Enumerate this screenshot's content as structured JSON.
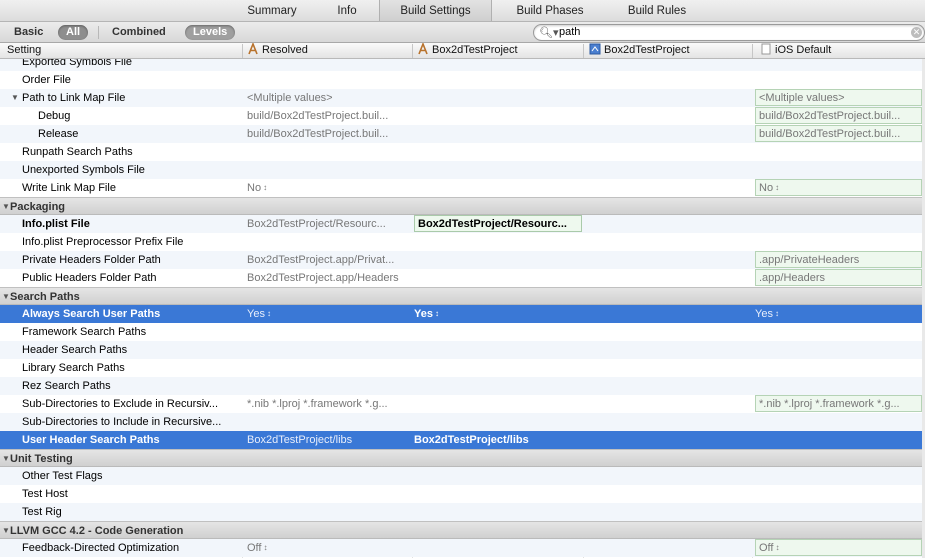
{
  "tabs": [
    {
      "label": "Summary",
      "active": false
    },
    {
      "label": "Info",
      "active": false
    },
    {
      "label": "Build Settings",
      "active": true
    },
    {
      "label": "Build Phases",
      "active": false
    },
    {
      "label": "Build Rules",
      "active": false
    }
  ],
  "filter": {
    "basic": "Basic",
    "all": "All",
    "combined": "Combined",
    "levels": "Levels",
    "search_value": "path",
    "search_icon": "magnifier-icon",
    "clear_icon": "clear-icon"
  },
  "columns": {
    "setting": "Setting",
    "resolved": "Resolved",
    "target": "Box2dTestProject",
    "project": "Box2dTestProject",
    "ios_default": "iOS Default"
  },
  "rows": [
    {
      "type": "setting",
      "name": "Exported Symbols File"
    },
    {
      "type": "setting",
      "name": "Order File"
    },
    {
      "type": "setting",
      "name": "Path to Link Map File",
      "expanded": true,
      "resolved": "<Multiple values>",
      "ios": "<Multiple values>"
    },
    {
      "type": "child",
      "name": "Debug",
      "resolved": "build/Box2dTestProject.buil...",
      "ios": "build/Box2dTestProject.buil..."
    },
    {
      "type": "child",
      "name": "Release",
      "resolved": "build/Box2dTestProject.buil...",
      "ios": "build/Box2dTestProject.buil..."
    },
    {
      "type": "setting",
      "name": "Runpath Search Paths"
    },
    {
      "type": "setting",
      "name": "Unexported Symbols File"
    },
    {
      "type": "setting",
      "name": "Write Link Map File",
      "resolved": "No",
      "resolved_stepper": true,
      "ios": "No",
      "ios_stepper": true
    },
    {
      "type": "section",
      "name": "Packaging"
    },
    {
      "type": "setting",
      "name": "Info.plist File",
      "bold": true,
      "resolved": "Box2dTestProject/Resourc...",
      "target": "Box2dTestProject/Resourc..."
    },
    {
      "type": "setting",
      "name": "Info.plist Preprocessor Prefix File"
    },
    {
      "type": "setting",
      "name": "Private Headers Folder Path",
      "resolved": "Box2dTestProject.app/Privat...",
      "ios": ".app/PrivateHeaders"
    },
    {
      "type": "setting",
      "name": "Public Headers Folder Path",
      "resolved": "Box2dTestProject.app/Headers",
      "ios": ".app/Headers"
    },
    {
      "type": "section",
      "name": "Search Paths"
    },
    {
      "type": "setting",
      "name": "Always Search User Paths",
      "bold": true,
      "selected": true,
      "resolved": "Yes",
      "resolved_stepper": true,
      "target": "Yes",
      "target_stepper": true,
      "ios": "Yes",
      "ios_stepper": true
    },
    {
      "type": "setting",
      "name": "Framework Search Paths"
    },
    {
      "type": "setting",
      "name": "Header Search Paths"
    },
    {
      "type": "setting",
      "name": "Library Search Paths"
    },
    {
      "type": "setting",
      "name": "Rez Search Paths"
    },
    {
      "type": "setting",
      "name": "Sub-Directories to Exclude in Recursiv...",
      "resolved": "*.nib *.lproj *.framework *.g...",
      "ios": "*.nib *.lproj *.framework *.g..."
    },
    {
      "type": "setting",
      "name": "Sub-Directories to Include in Recursive..."
    },
    {
      "type": "setting",
      "name": "User Header Search Paths",
      "bold": true,
      "selected": true,
      "resolved": "Box2dTestProject/libs",
      "target": "Box2dTestProject/libs"
    },
    {
      "type": "section",
      "name": "Unit Testing"
    },
    {
      "type": "setting",
      "name": "Other Test Flags"
    },
    {
      "type": "setting",
      "name": "Test Host"
    },
    {
      "type": "setting",
      "name": "Test Rig"
    },
    {
      "type": "section",
      "name": "LLVM GCC 4.2 - Code Generation"
    },
    {
      "type": "setting",
      "name": "Feedback-Directed Optimization",
      "resolved": "Off",
      "resolved_stepper": true,
      "ios": "Off",
      "ios_stepper": true
    }
  ],
  "colors": {
    "selection": "#3a78d6",
    "alt_row": "#f2f6fb",
    "defined_cell": "#eef8ee"
  }
}
